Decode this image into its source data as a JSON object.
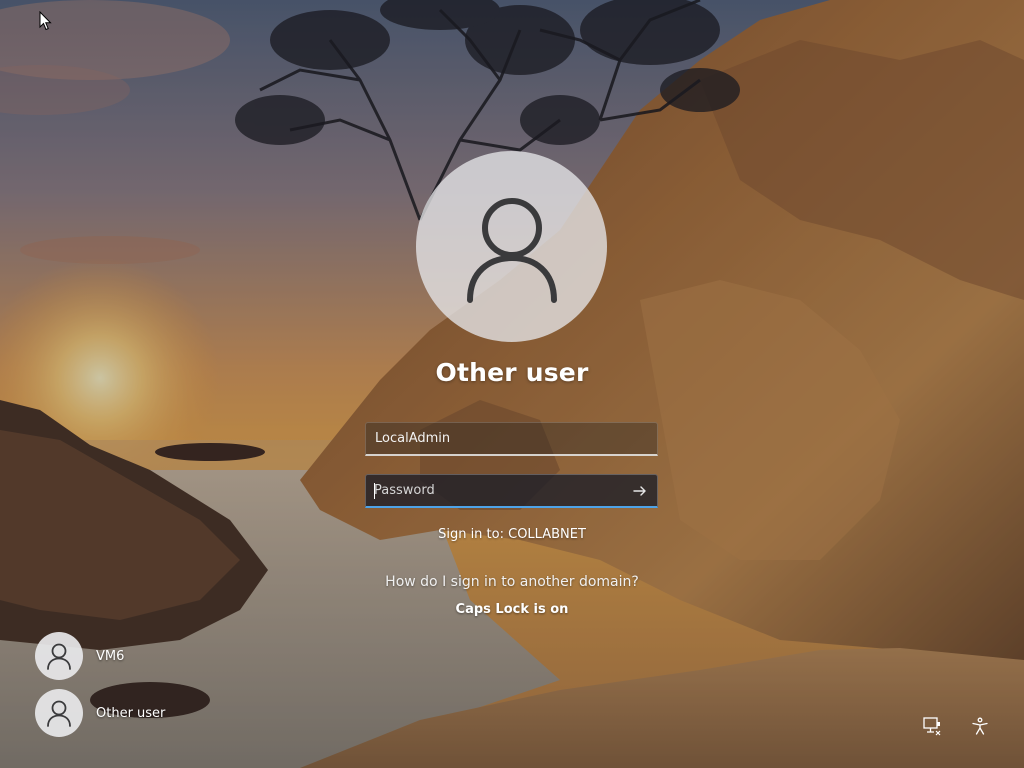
{
  "user": {
    "display_name": "Other user"
  },
  "form": {
    "username_value": "LocalAdmin",
    "password_placeholder": "Password",
    "submit_icon": "arrow-right-icon"
  },
  "sign_in_to": "Sign in to: COLLABNET",
  "other_domain_link": "How do I sign in to another domain?",
  "caps_lock_warning": "Caps Lock is on",
  "user_switcher": [
    {
      "label": "VM6",
      "icon": "person-icon"
    },
    {
      "label": "Other user",
      "icon": "person-icon"
    }
  ],
  "system_buttons": [
    {
      "name": "network",
      "icon": "network-icon"
    },
    {
      "name": "accessibility",
      "icon": "accessibility-icon"
    }
  ],
  "colors": {
    "focus_accent": "#4ea3e8",
    "avatar_fill": "#e6e6e8",
    "avatar_glyph": "#3a3a3c"
  }
}
